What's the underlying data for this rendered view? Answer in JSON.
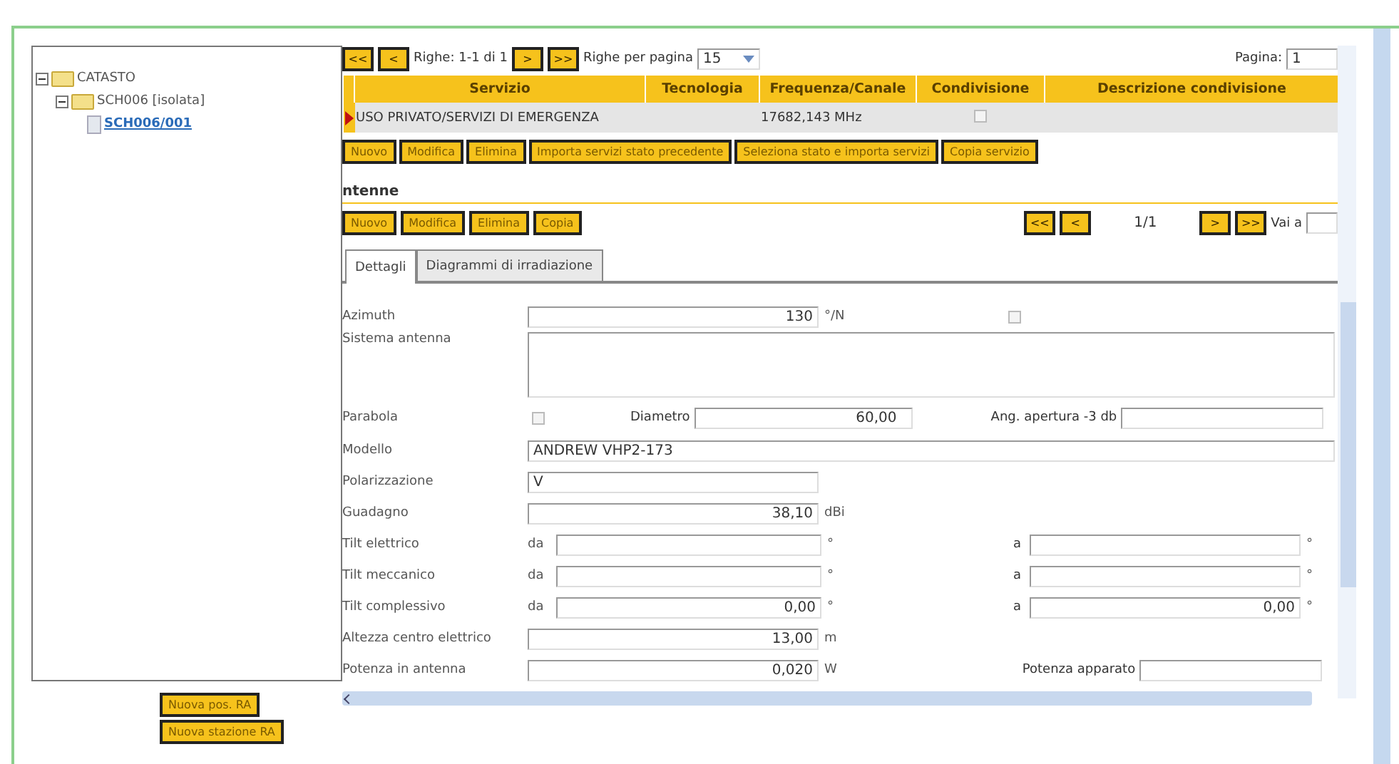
{
  "tree": {
    "label": "CATASTO",
    "expanded": true,
    "children": [
      {
        "label": "SCH006 [isolata]",
        "expanded": true,
        "children": [
          {
            "label": "SCH006/001",
            "selected": true
          }
        ]
      }
    ]
  },
  "tree_buttons": [
    "Nuova pos. RA",
    "Nuova stazione RA"
  ],
  "pager": {
    "first": "<<",
    "prev": "<",
    "rows_label": "Righe: 1-1 di 1",
    "next": ">",
    "last": ">>",
    "per_page_label": "Righe per pagina",
    "per_page": "15",
    "page_label": "Pagina:",
    "page": "1"
  },
  "table": {
    "columns": [
      "Servizio",
      "Tecnologia",
      "Frequenza/Canale",
      "Condivisione",
      "Descrizione condivisione"
    ],
    "rows": [
      {
        "selected": true,
        "servizio": "USO PRIVATO/SERVIZI DI EMERGENZA",
        "frequenza": "17682,143 MHz",
        "condivisione": false
      }
    ]
  },
  "service_buttons": [
    "Nuovo",
    "Modifica",
    "Elimina",
    "Importa servizi stato precedente",
    "Seleziona stato e importa servizi",
    "Copia servizio"
  ],
  "antenne": {
    "title": "ntenne",
    "buttons": [
      "Nuovo",
      "Modifica",
      "Elimina",
      "Copia"
    ],
    "pager": {
      "first": "<<",
      "prev": "<",
      "position": "1/1",
      "next": ">",
      "last": ">>",
      "goto_label": "Vai a"
    }
  },
  "tabs": [
    {
      "label": "Dettagli",
      "selected": true
    },
    {
      "label": "Diagrammi di irradiazione",
      "selected": false
    }
  ],
  "form": [
    {
      "kind": "number",
      "label": "Azimuth",
      "value": "130",
      "unit": "°/N",
      "side_checkbox": {
        "checked": false
      }
    },
    {
      "kind": "textarea",
      "label": "Sistema antenna"
    },
    {
      "kind": "parabola",
      "label": "Parabola",
      "checked": false,
      "diameter_label": "Diametro",
      "diameter": "60,00",
      "angle_label": "Ang. apertura -3 db"
    },
    {
      "kind": "text",
      "label": "Modello",
      "value": "ANDREW VHP2-173",
      "wide": true
    },
    {
      "kind": "text",
      "label": "Polarizzazione",
      "value": "V",
      "wide": false
    },
    {
      "kind": "number",
      "label": "Guadagno",
      "value": "38,10",
      "unit": "dBi"
    },
    {
      "kind": "range",
      "label": "Tilt elettrico",
      "from_label": "da",
      "from_unit": "°",
      "to_label": "a",
      "to_unit": "°"
    },
    {
      "kind": "range",
      "label": "Tilt meccanico",
      "from_label": "da",
      "from_unit": "°",
      "to_label": "a",
      "to_unit": "°"
    },
    {
      "kind": "range",
      "label": "Tilt complessivo",
      "from_label": "da",
      "from_value": "0,00",
      "from_unit": "°",
      "to_label": "a",
      "to_value": "0,00",
      "to_unit": "°"
    },
    {
      "kind": "number",
      "label": "Altezza centro elettrico",
      "value": "13,00",
      "unit": "m"
    },
    {
      "kind": "number",
      "label": "Potenza in antenna",
      "value": "0,020",
      "unit": "W",
      "extra_label": "Potenza apparato"
    }
  ]
}
